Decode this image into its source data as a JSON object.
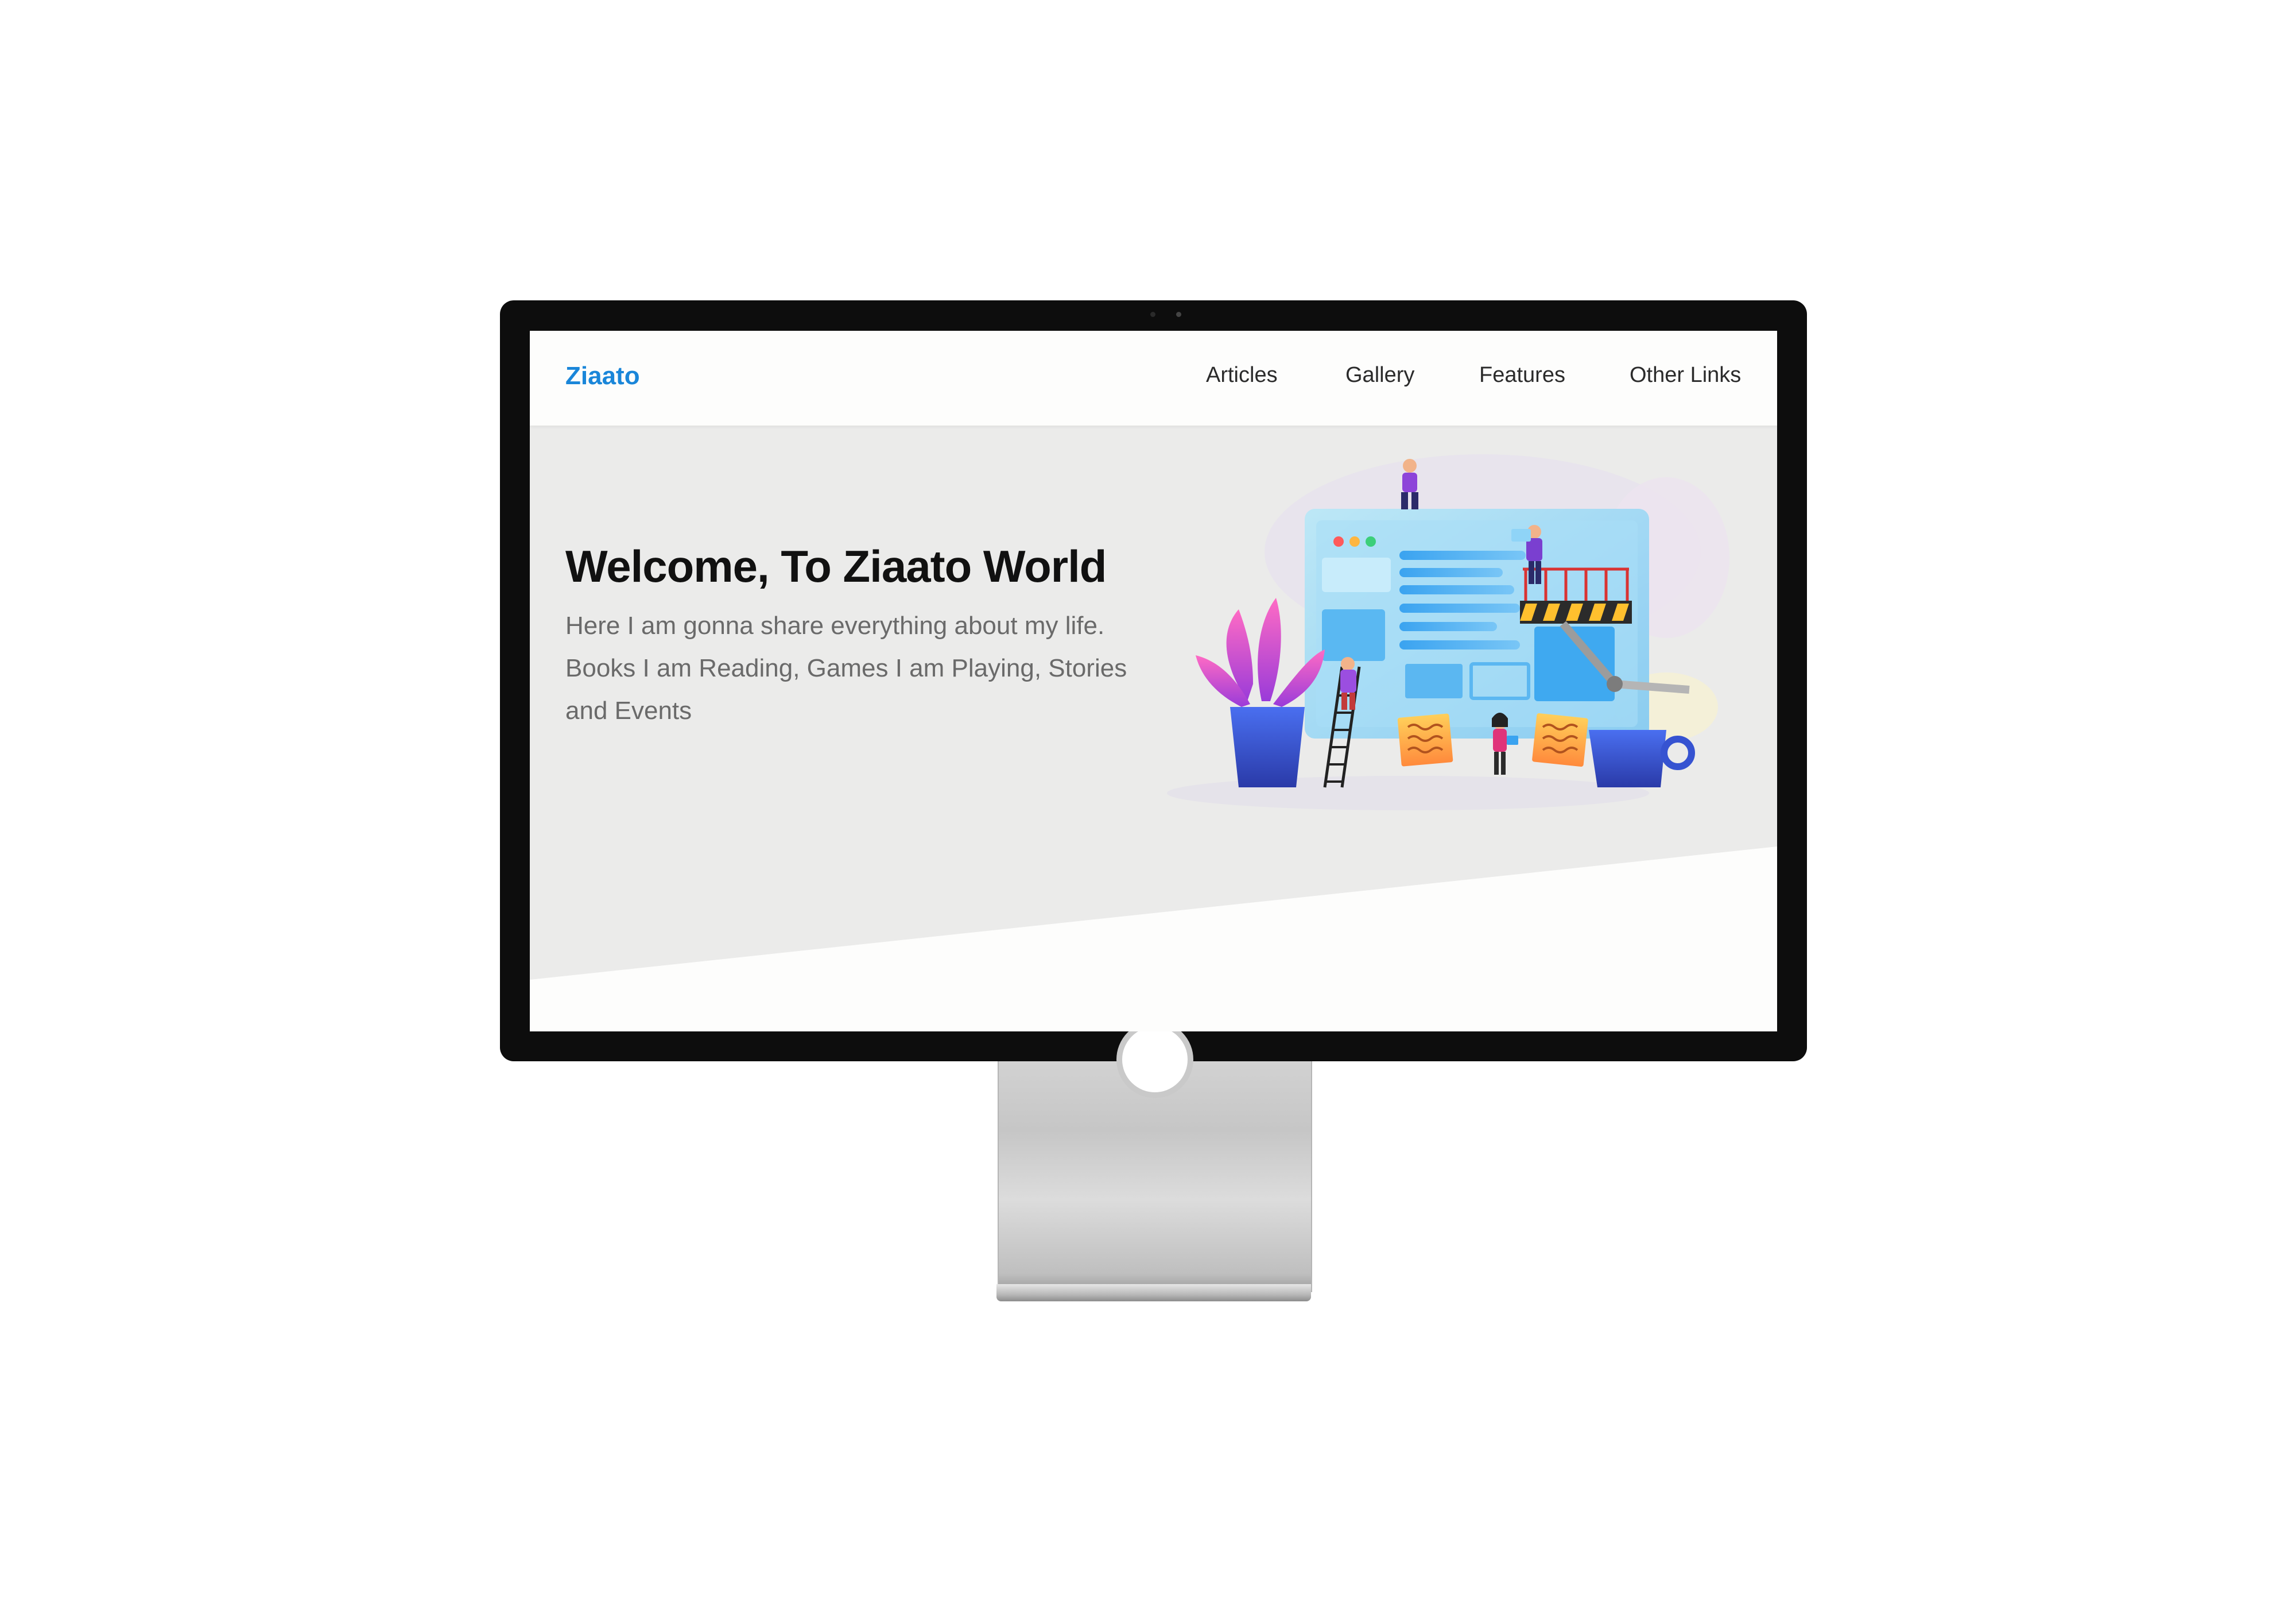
{
  "site": {
    "brand": "Ziaato"
  },
  "nav": {
    "items": [
      {
        "label": "Articles"
      },
      {
        "label": "Gallery"
      },
      {
        "label": "Features"
      },
      {
        "label": "Other Links"
      }
    ]
  },
  "hero": {
    "title": "Welcome, To Ziaato World",
    "text": "Here I am gonna share everything about my life. Books I am Reading, Games I am Playing, Stories and Events",
    "illustration_icon": "website-builders-illustration"
  },
  "colors": {
    "brand": "#1a86d9",
    "hero_bg": "#ebebea",
    "page_bg": "#fdfdfc",
    "bezel": "#0d0d0d"
  }
}
